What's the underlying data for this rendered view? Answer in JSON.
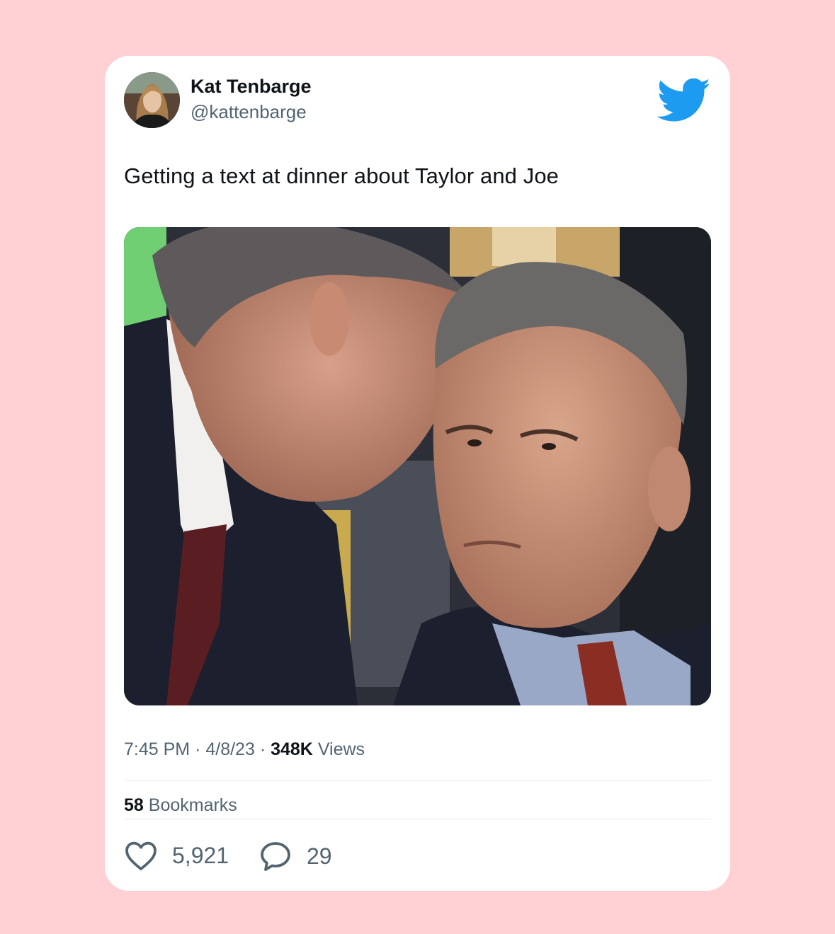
{
  "tweet": {
    "author": {
      "name": "Kat Tenbarge",
      "handle": "@kattenbarge"
    },
    "text": "Getting a text at dinner about Taylor and Joe",
    "time": "7:45 PM",
    "date": "4/8/23",
    "separator": "·",
    "views_count": "348K",
    "views_label": "Views",
    "bookmarks_count": "58",
    "bookmarks_label": "Bookmarks",
    "likes": "5,921",
    "replies": "29"
  },
  "colors": {
    "background": "#ffd1d4",
    "card": "#ffffff",
    "twitter_blue": "#1d9bf0",
    "text_primary": "#0f1419",
    "text_secondary": "#536471"
  },
  "icons": {
    "logo": "twitter-bird-icon",
    "like": "heart-icon",
    "reply": "speech-bubble-icon"
  }
}
